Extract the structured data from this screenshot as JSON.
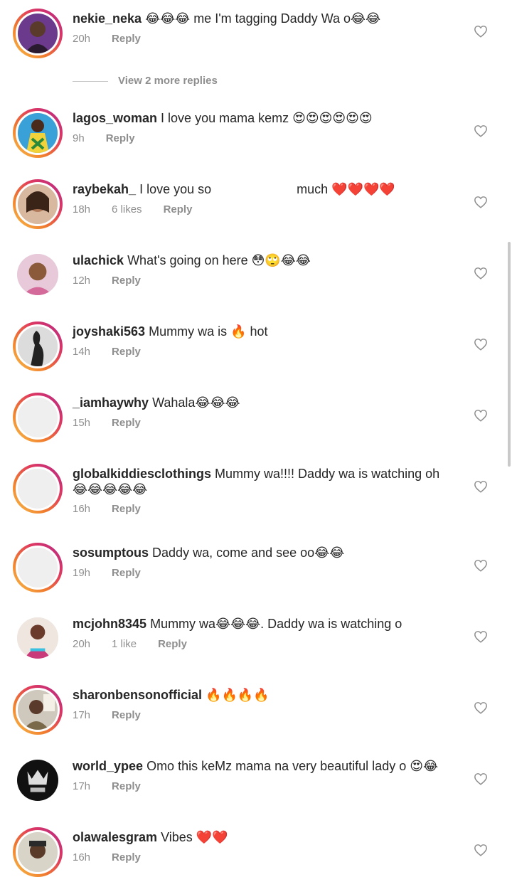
{
  "view_more_label": "View 2 more replies",
  "reply_label": "Reply",
  "comments": [
    {
      "username": "nekie_neka",
      "text": "😂😂😂 me I'm tagging Daddy Wa o😂😂",
      "time": "20h",
      "likes": "",
      "avatar": "photo-woman-purple"
    },
    {
      "username": "lagos_woman",
      "text": "I love you mama kemz 😍😍😍😍😍😍",
      "time": "9h",
      "likes": "",
      "avatar": "photo-colorful-outfit"
    },
    {
      "username": "raybekah_",
      "text_before": "I love you so",
      "text_after": "much ❤️❤️❤️❤️",
      "time": "18h",
      "likes": "6 likes",
      "avatar": "photo-woman-selfie"
    },
    {
      "username": "ulachick",
      "text": "What's going on here 😳🙄😂😂",
      "time": "12h",
      "likes": "",
      "avatar": "photo-woman-pink"
    },
    {
      "username": "joyshaki563",
      "text": "Mummy wa is 🔥 hot",
      "time": "14h",
      "likes": "",
      "avatar": "photo-silhouette"
    },
    {
      "username": "_iamhaywhy",
      "text": "Wahala😂😂😂",
      "time": "15h",
      "likes": "",
      "avatar": "default-grey"
    },
    {
      "username": "globalkiddiesclothings",
      "text": "Mummy wa!!!! Daddy wa is watching oh 😂😂😂😂😂",
      "time": "16h",
      "likes": "",
      "avatar": "default-grey"
    },
    {
      "username": "sosumptous",
      "text": "Daddy wa, come and see oo😂😂",
      "time": "19h",
      "likes": "",
      "avatar": "default-grey"
    },
    {
      "username": "mcjohn8345",
      "text": "Mummy wa😂😂😂. Daddy wa is watching o",
      "time": "20h",
      "likes": "1 like",
      "avatar": "photo-woman-colorful"
    },
    {
      "username": "sharonbensonofficial",
      "text": "🔥🔥🔥🔥",
      "time": "17h",
      "likes": "",
      "avatar": "photo-man-room"
    },
    {
      "username": "world_ypee",
      "text": "Omo this keMz mama na very beautiful lady o 😍😂",
      "time": "17h",
      "likes": "",
      "avatar": "logo-dark"
    },
    {
      "username": "olawalesgram",
      "text": "Vibes ❤️❤️",
      "time": "16h",
      "likes": "",
      "avatar": "photo-man-cap"
    }
  ]
}
